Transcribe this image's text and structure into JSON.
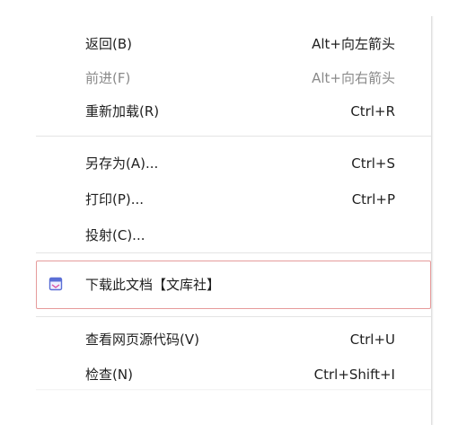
{
  "menu": {
    "items": [
      {
        "label": "返回(B)",
        "shortcut": "Alt+向左箭头"
      },
      {
        "label": "前进(F)",
        "shortcut": "Alt+向右箭头"
      },
      {
        "label": "重新加载(R)",
        "shortcut": "Ctrl+R"
      },
      {
        "label": "另存为(A)...",
        "shortcut": "Ctrl+S"
      },
      {
        "label": "打印(P)...",
        "shortcut": "Ctrl+P"
      },
      {
        "label": "投射(C)..."
      },
      {
        "label": "下载此文档【文库社】",
        "icon": "document-download-icon"
      },
      {
        "label": "查看网页源代码(V)",
        "shortcut": "Ctrl+U"
      },
      {
        "label": "检查(N)",
        "shortcut": "Ctrl+Shift+I"
      }
    ]
  },
  "colors": {
    "highlight_border": "#e69b9b",
    "disabled_text": "#8a8a8a",
    "icon_accent": "#5b6fd6"
  }
}
